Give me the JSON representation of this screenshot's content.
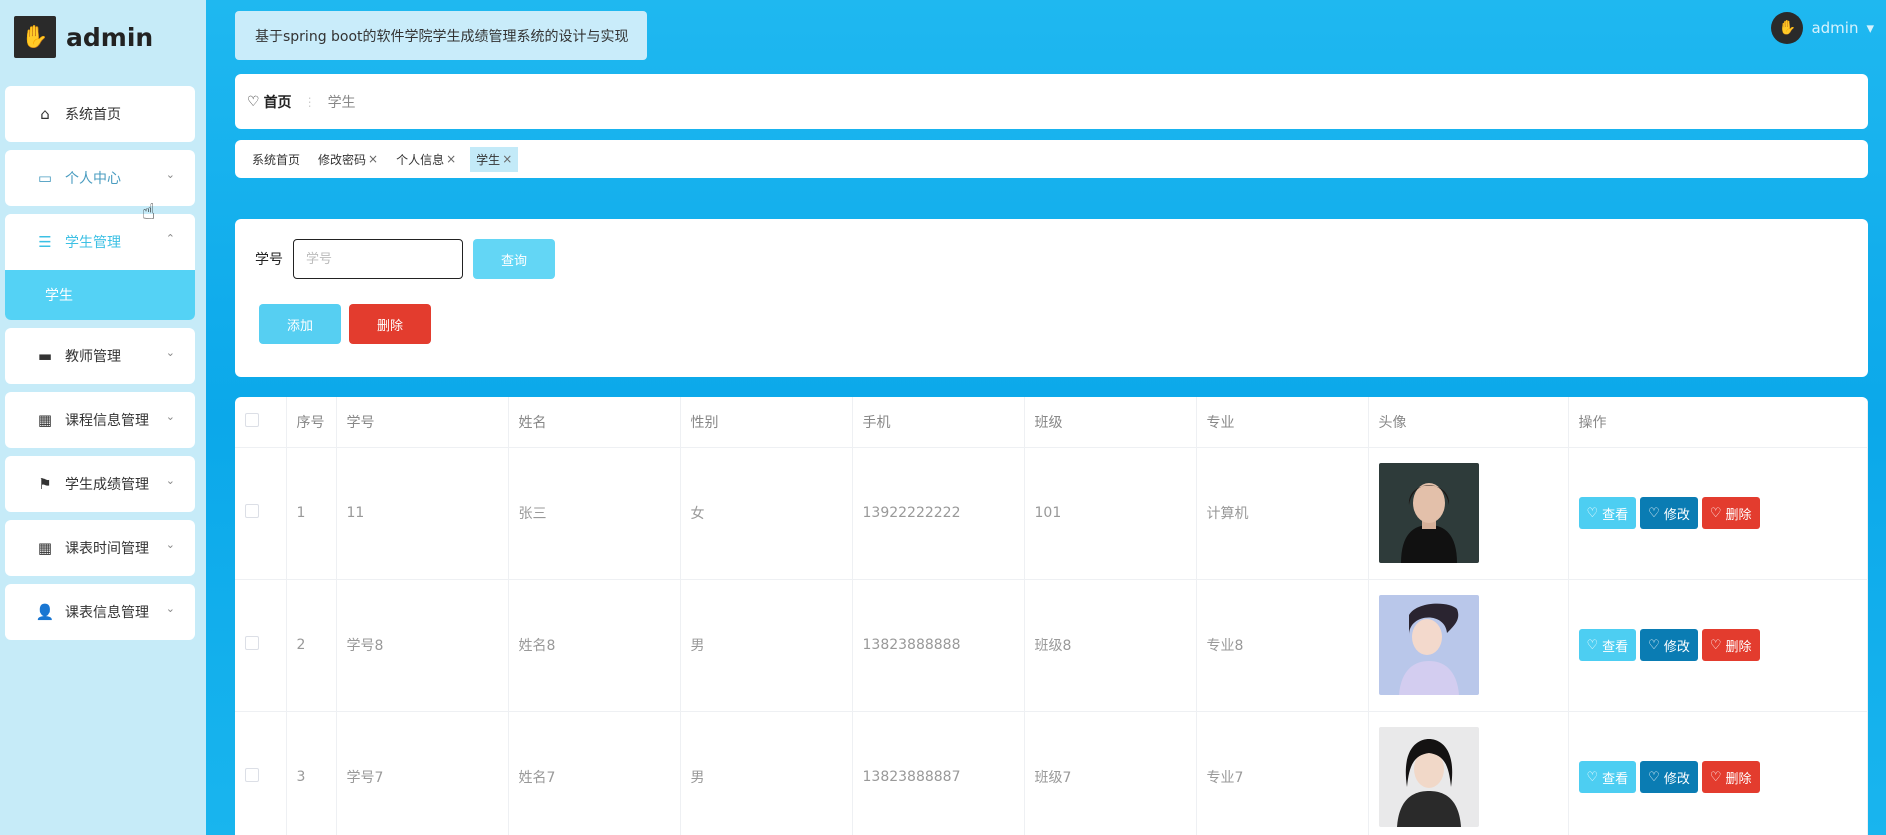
{
  "brand": {
    "name": "admin"
  },
  "sidebar": {
    "items": [
      {
        "label": "系统首页",
        "icon": "home-icon"
      },
      {
        "label": "个人中心",
        "icon": "card-icon"
      },
      {
        "label": "学生管理",
        "icon": "list-icon",
        "sub": [
          "学生"
        ]
      },
      {
        "label": "教师管理",
        "icon": "monitor-icon"
      },
      {
        "label": "课程信息管理",
        "icon": "grid-icon"
      },
      {
        "label": "学生成绩管理",
        "icon": "flag-icon"
      },
      {
        "label": "课表时间管理",
        "icon": "grid-icon"
      },
      {
        "label": "课表信息管理",
        "icon": "user-icon"
      }
    ]
  },
  "header": {
    "title": "基于spring boot的软件学院学生成绩管理系统的设计与实现",
    "user": "admin"
  },
  "breadcrumb": {
    "home": "首页",
    "current": "学生"
  },
  "tags": [
    {
      "label": "系统首页",
      "closable": false
    },
    {
      "label": "修改密码",
      "closable": true
    },
    {
      "label": "个人信息",
      "closable": true
    },
    {
      "label": "学生",
      "closable": true,
      "active": true
    }
  ],
  "search": {
    "label": "学号",
    "placeholder": "学号",
    "query_label": "查询",
    "add_label": "添加",
    "delete_label": "删除"
  },
  "table": {
    "columns": [
      "序号",
      "学号",
      "姓名",
      "性别",
      "手机",
      "班级",
      "专业",
      "头像",
      "操作"
    ],
    "rows": [
      {
        "no": "1",
        "id": "11",
        "name": "张三",
        "gender": "女",
        "phone": "13922222222",
        "class": "101",
        "major": "计算机"
      },
      {
        "no": "2",
        "id": "学号8",
        "name": "姓名8",
        "gender": "男",
        "phone": "13823888888",
        "class": "班级8",
        "major": "专业8"
      },
      {
        "no": "3",
        "id": "学号7",
        "name": "姓名7",
        "gender": "男",
        "phone": "13823888887",
        "class": "班级7",
        "major": "专业7"
      }
    ],
    "actions": {
      "view": "查看",
      "edit": "修改",
      "delete": "删除"
    }
  },
  "colors": {
    "sidebar_bg": "#c6ebf8",
    "main_bg": "#0ba8ea",
    "accent": "#56cff2",
    "danger": "#e33c2e",
    "edit": "#0a7cb3"
  }
}
